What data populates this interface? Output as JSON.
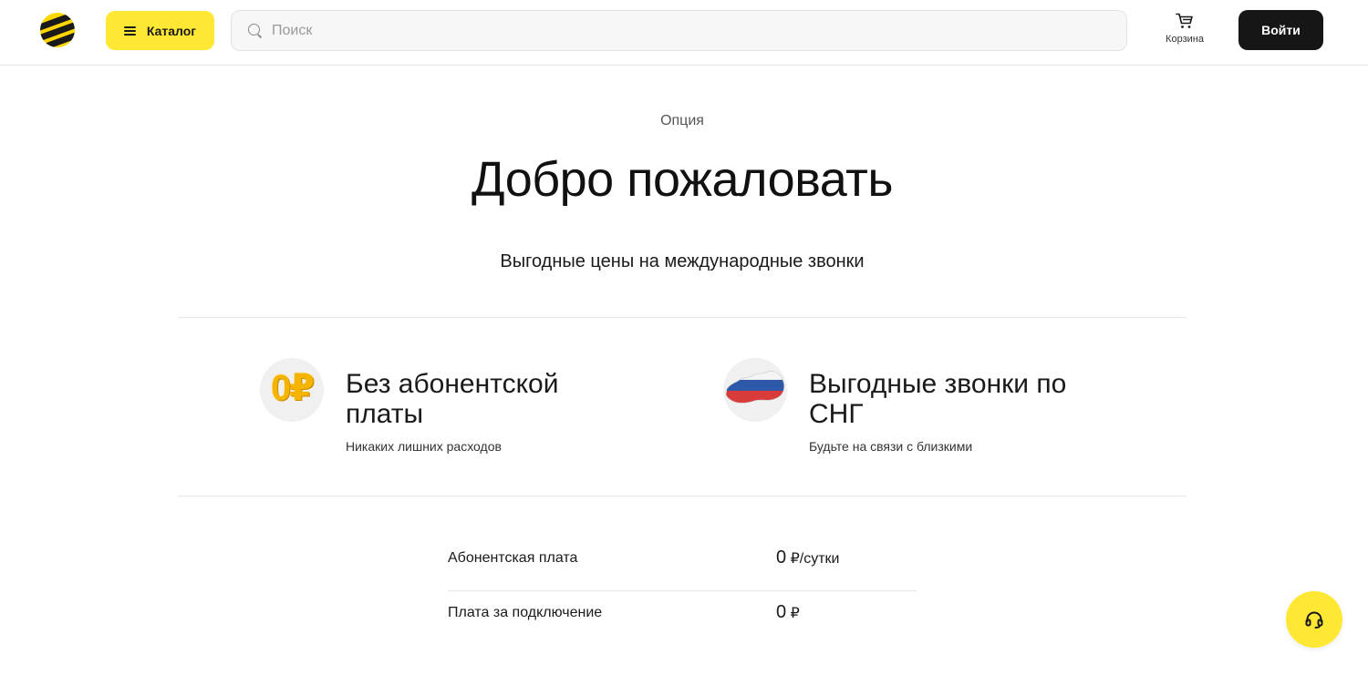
{
  "header": {
    "catalog_label": "Каталог",
    "search_placeholder": "Поиск",
    "cart_label": "Корзина",
    "login_label": "Войти",
    "brand_color": "#ffe833"
  },
  "hero": {
    "eyebrow": "Опция",
    "title": "Добро пожаловать",
    "subtitle": "Выгодные цены на международные звонки"
  },
  "features": [
    {
      "icon": "zero-ruble-coin-icon",
      "icon_text": "0₽",
      "title": "Без абонентской платы",
      "description": "Никаких лишних расходов"
    },
    {
      "icon": "russia-map-icon",
      "title": "Выгодные звонки по СНГ",
      "description": "Будьте на связи с близкими"
    }
  ],
  "prices": [
    {
      "label": "Абонентская плата",
      "value": "0",
      "unit": "₽/сутки"
    },
    {
      "label": "Плата за подключение",
      "value": "0",
      "unit": "₽"
    }
  ]
}
